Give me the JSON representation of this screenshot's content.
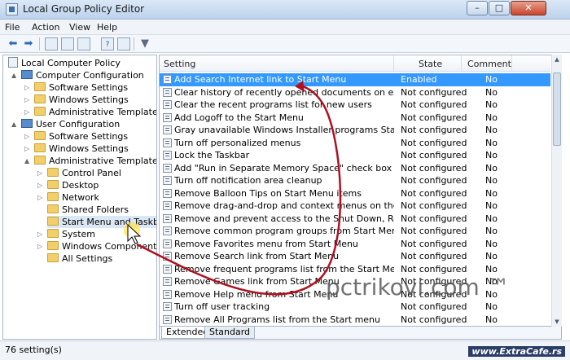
{
  "window": {
    "title": "Local Group Policy Editor",
    "min_label": "–",
    "max_label": "□",
    "close_label": "✕"
  },
  "menu": [
    "File",
    "Action",
    "View",
    "Help"
  ],
  "tree": [
    {
      "label": "Local Computer Policy",
      "icon": "policy-icon"
    },
    {
      "label": "Computer Configuration",
      "icon": "computer-icon",
      "expander": "▲"
    },
    {
      "label": "Software Settings",
      "icon": "folder-icon",
      "expander": "▷"
    },
    {
      "label": "Windows Settings",
      "icon": "folder-icon",
      "expander": "▷"
    },
    {
      "label": "Administrative Templates",
      "icon": "folder-icon",
      "expander": "▷"
    },
    {
      "label": "User Configuration",
      "icon": "computer-icon",
      "expander": "▲"
    },
    {
      "label": "Software Settings",
      "icon": "folder-icon",
      "expander": "▷"
    },
    {
      "label": "Windows Settings",
      "icon": "folder-icon",
      "expander": "▷"
    },
    {
      "label": "Administrative Templates",
      "icon": "folder-icon",
      "expander": "▲"
    },
    {
      "label": "Control Panel",
      "icon": "folder-icon",
      "expander": "▷"
    },
    {
      "label": "Desktop",
      "icon": "folder-icon",
      "expander": "▷"
    },
    {
      "label": "Network",
      "icon": "folder-icon",
      "expander": "▷"
    },
    {
      "label": "Shared Folders",
      "icon": "folder-icon"
    },
    {
      "label": "Start Menu and Taskbar",
      "icon": "folder-icon",
      "selected": true
    },
    {
      "label": "System",
      "icon": "folder-icon",
      "expander": "▷"
    },
    {
      "label": "Windows Components",
      "icon": "folder-icon",
      "expander": "▷"
    },
    {
      "label": "All Settings",
      "icon": "folder-icon"
    }
  ],
  "columns": {
    "setting": "Setting",
    "state": "State",
    "comment": "Comment"
  },
  "settings": [
    {
      "name": "Add Search Internet link to Start Menu",
      "state": "Enabled",
      "comment": "No",
      "selected": true
    },
    {
      "name": "Clear history of recently opened documents on exit",
      "state": "Not configured",
      "comment": "No"
    },
    {
      "name": "Clear the recent programs list for new users",
      "state": "Not configured",
      "comment": "No"
    },
    {
      "name": "Add Logoff to the Start Menu",
      "state": "Not configured",
      "comment": "No"
    },
    {
      "name": "Gray unavailable Windows Installer programs Start Menu sh",
      "state": "Not configured",
      "comment": "No"
    },
    {
      "name": "Turn off personalized menus",
      "state": "Not configured",
      "comment": "No"
    },
    {
      "name": "Lock the Taskbar",
      "state": "Not configured",
      "comment": "No"
    },
    {
      "name": "Add \"Run in Separate Memory Space\" check box to Run dial...",
      "state": "Not configured",
      "comment": "No"
    },
    {
      "name": "Turn off notification area cleanup",
      "state": "Not configured",
      "comment": "No"
    },
    {
      "name": "Remove Balloon Tips on Start Menu items",
      "state": "Not configured",
      "comment": "No"
    },
    {
      "name": "Remove drag-and-drop and context menus on the Start Me...",
      "state": "Not configured",
      "comment": "No"
    },
    {
      "name": "Remove and prevent access to the Shut Down, Restart, Sleep...",
      "state": "Not configured",
      "comment": "No"
    },
    {
      "name": "Remove common program groups from Start Menu",
      "state": "Not configured",
      "comment": "No"
    },
    {
      "name": "Remove Favorites menu from Start Menu",
      "state": "Not configured",
      "comment": "No"
    },
    {
      "name": "Remove Search link from Start Menu",
      "state": "Not configured",
      "comment": "No"
    },
    {
      "name": "Remove frequent programs list from the Start Menu",
      "state": "Not configured",
      "comment": "No"
    },
    {
      "name": "Remove Games link from Start Menu",
      "state": "Not configured",
      "comment": "No"
    },
    {
      "name": "Remove Help menu from Start Menu",
      "state": "Not configured",
      "comment": "No"
    },
    {
      "name": "Turn off user tracking",
      "state": "Not configured",
      "comment": "No"
    },
    {
      "name": "Remove All Programs list from the Start menu",
      "state": "Not configured",
      "comment": "No"
    }
  ],
  "tabs": [
    "Extended",
    "Standard"
  ],
  "status": {
    "count": "76 setting(s)",
    "watermark": "www.ExtraCafe.rs"
  },
  "overlay": {
    "site_watermark": "pctrikovi.com ™",
    "arrow_color": "#b01020"
  },
  "colors": {
    "selection": "#3399ff",
    "titlebar": "#c7daf0"
  }
}
